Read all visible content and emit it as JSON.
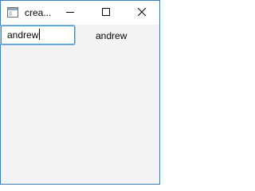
{
  "window": {
    "title": "crea...",
    "icons": {
      "app": "app-window-icon",
      "minimize": "minimize-icon",
      "maximize": "maximize-icon",
      "close": "close-icon"
    }
  },
  "form": {
    "input_value": "andrew",
    "echo_label": "andrew"
  },
  "colors": {
    "focus_border": "#2a91d7",
    "background": "#f3f3f3",
    "titlebar": "#ffffff"
  }
}
